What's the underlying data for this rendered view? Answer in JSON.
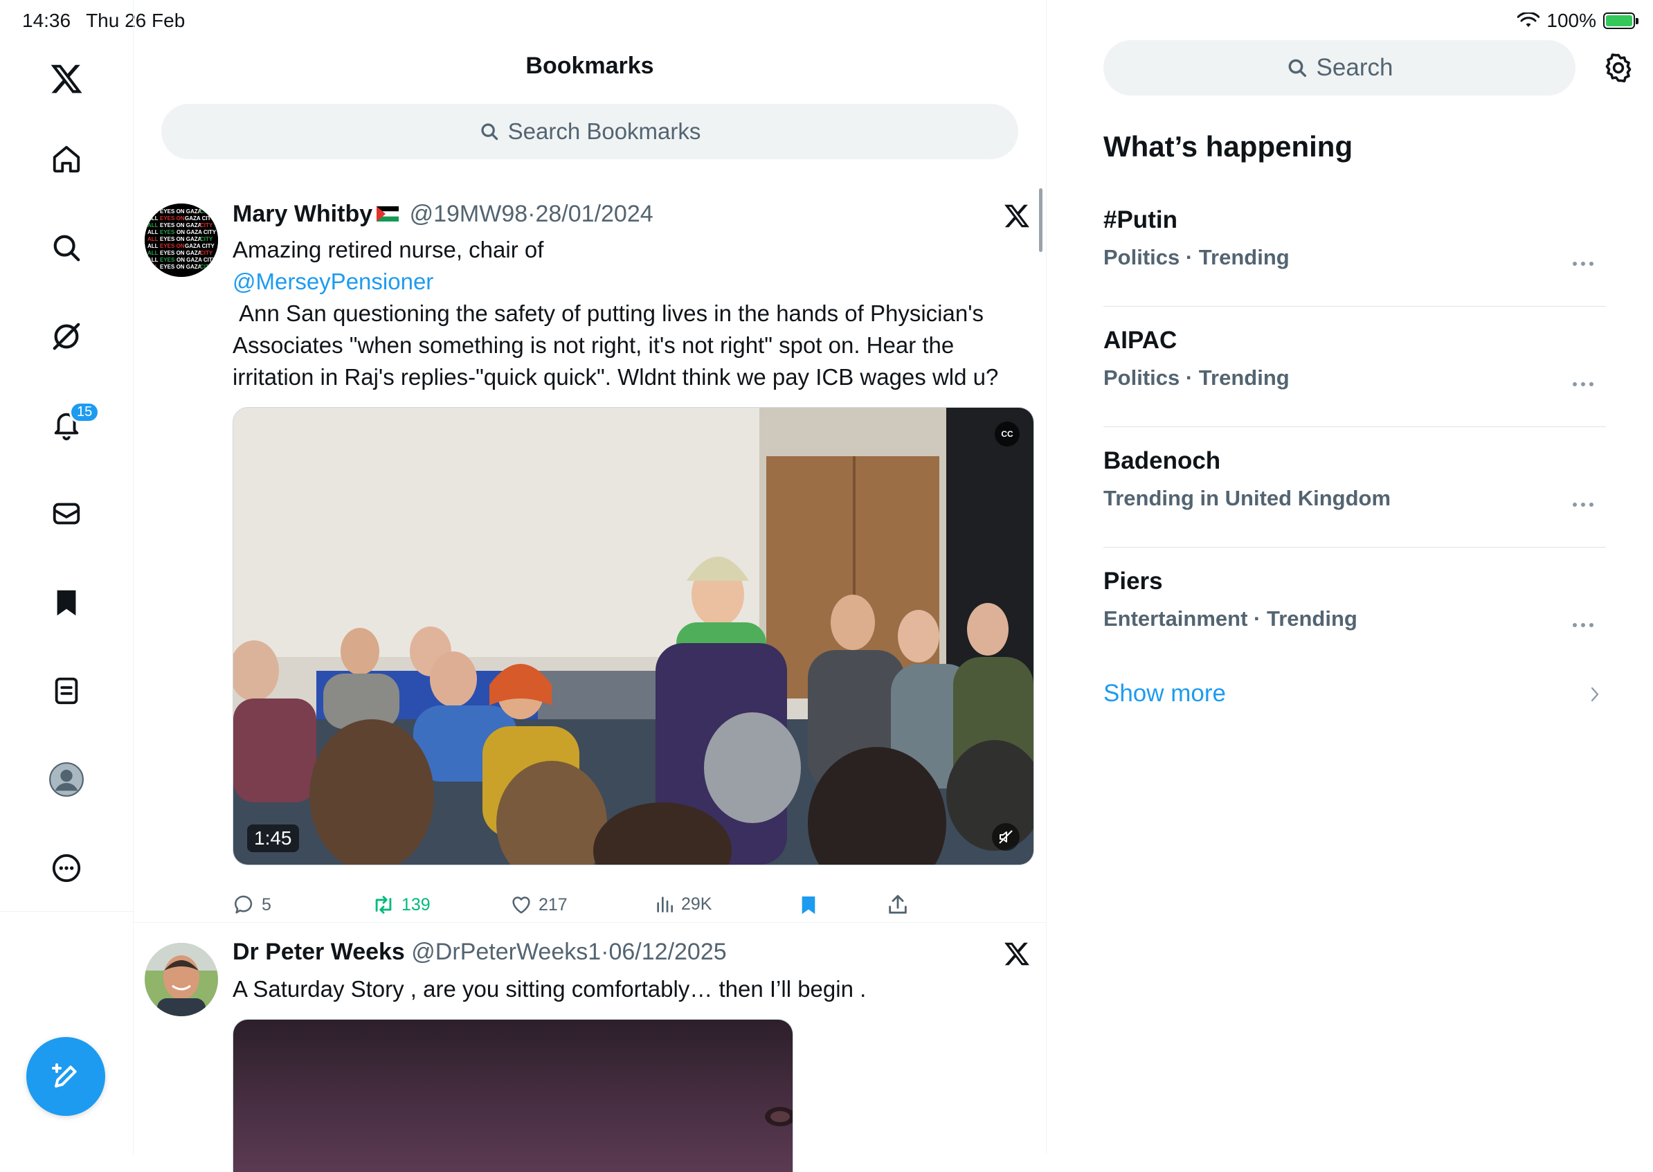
{
  "status": {
    "time": "14:36",
    "date": "Thu 26 Feb",
    "battery": "100%"
  },
  "nav": {
    "notification_count": "15",
    "items": [
      "x-logo",
      "home-icon",
      "search-icon",
      "grok-icon",
      "bell-icon",
      "mail-icon",
      "bookmark-icon",
      "lists-icon",
      "profile-icon",
      "more-icon"
    ]
  },
  "main": {
    "title": "Bookmarks",
    "search_placeholder": "Search Bookmarks",
    "tweets": [
      {
        "name": "Mary Whitby",
        "handle": "@19MW98",
        "sep": "·",
        "date": "28/01/2024",
        "text_line1": "Amazing retired nurse, chair of",
        "mention": "@MerseyPensioner",
        "text_rest": " Ann San questioning the safety of putting lives in the hands of Physician's Associates \"when something is not right, it's not right\" spot on. Hear the irritation in Raj's replies-\"quick quick\". Wldnt think we pay ICB wages wld u?",
        "video_duration": "1:45",
        "cc_label": "CC",
        "replies": "5",
        "retweets": "139",
        "likes": "217",
        "views": "29K"
      },
      {
        "name": "Dr Peter Weeks",
        "handle": "@DrPeterWeeks1",
        "sep": "·",
        "date": "06/12/2025",
        "text": "A Saturday Story , are you sitting comfortably… then I’ll begin ."
      }
    ]
  },
  "sidebar": {
    "search_placeholder": "Search",
    "heading": "What’s happening",
    "trends": [
      {
        "topic": "#Putin",
        "context": "Politics · Trending"
      },
      {
        "topic": "AIPAC",
        "context": "Politics · Trending"
      },
      {
        "topic": "Badenoch",
        "context": "Trending in United Kingdom"
      },
      {
        "topic": "Piers",
        "context": "Entertainment · Trending"
      }
    ],
    "show_more": "Show more"
  },
  "colors": {
    "accent": "#1d9bf0",
    "retweet": "#00ba7c",
    "muted": "#536471",
    "text": "#0f1419"
  }
}
